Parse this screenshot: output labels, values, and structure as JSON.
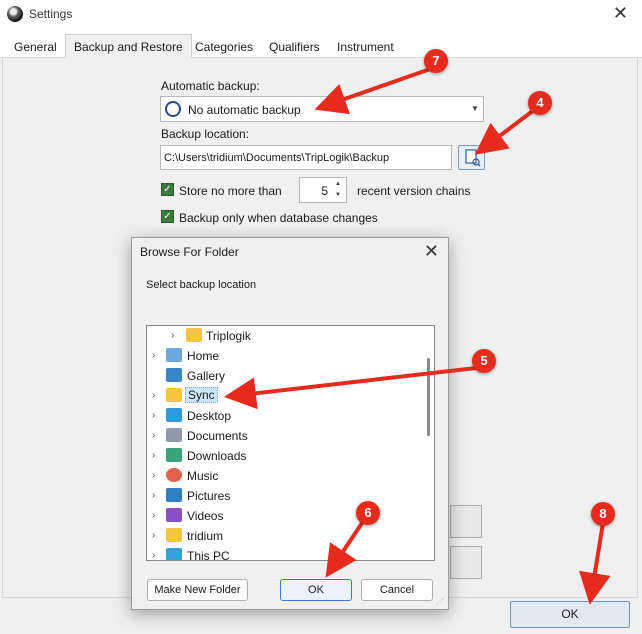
{
  "window": {
    "title": "Settings"
  },
  "tabs": [
    {
      "label": "General"
    },
    {
      "label": "Backup and Restore"
    },
    {
      "label": "Categories"
    },
    {
      "label": "Qualifiers"
    },
    {
      "label": "Instrument"
    }
  ],
  "backup": {
    "auto_label": "Automatic backup:",
    "auto_value": "No automatic backup",
    "location_label": "Backup location:",
    "location_value": "C:\\Users\\tridium\\Documents\\TripLogik\\Backup",
    "store_prefix": "Store no more than",
    "store_count": "5",
    "store_suffix": "recent version chains",
    "only_changes_label": "Backup only when database changes"
  },
  "footer": {
    "ok_label": "OK"
  },
  "dialog": {
    "title": "Browse For Folder",
    "prompt": "Select backup location",
    "tree": [
      {
        "label": "Triplogik",
        "icon": "folder-icon"
      },
      {
        "label": "Home",
        "icon": "home-icon"
      },
      {
        "label": "Gallery",
        "icon": "gallery-icon"
      },
      {
        "label": "Sync",
        "icon": "folder-icon"
      },
      {
        "label": "Desktop",
        "icon": "desktop-icon"
      },
      {
        "label": "Documents",
        "icon": "documents-icon"
      },
      {
        "label": "Downloads",
        "icon": "downloads-icon"
      },
      {
        "label": "Music",
        "icon": "music-icon"
      },
      {
        "label": "Pictures",
        "icon": "pictures-icon"
      },
      {
        "label": "Videos",
        "icon": "videos-icon"
      },
      {
        "label": "tridium",
        "icon": "folder-icon"
      },
      {
        "label": "This PC",
        "icon": "computer-icon"
      }
    ],
    "new_folder_label": "Make New Folder",
    "ok_label": "OK",
    "cancel_label": "Cancel"
  },
  "callouts": {
    "c4": "4",
    "c5": "5",
    "c6": "6",
    "c7": "7",
    "c8": "8"
  },
  "colors": {
    "annotation_red": "#e52b1e",
    "selection": "#cce8ff",
    "folder": "#f5c542"
  }
}
